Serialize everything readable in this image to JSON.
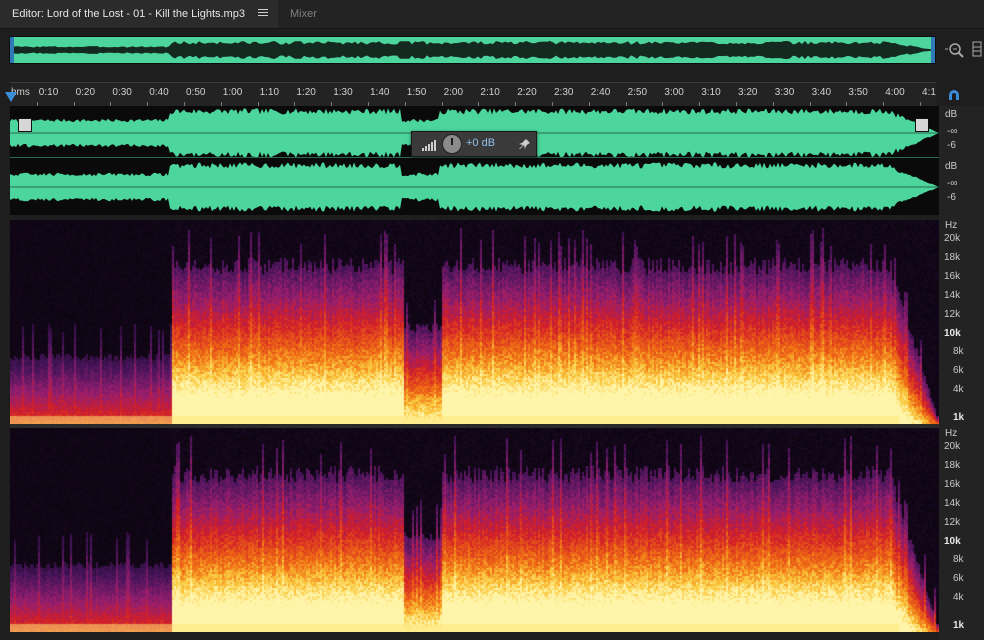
{
  "tabs": {
    "editor_label": "Editor: Lord of the Lost - 01 - Kill the Lights.mp3",
    "mixer_label": "Mixer"
  },
  "ruler": {
    "labels": [
      "hms",
      "0:10",
      "0:20",
      "0:30",
      "0:40",
      "0:50",
      "1:00",
      "1:10",
      "1:20",
      "1:30",
      "1:40",
      "1:50",
      "2:00",
      "2:10",
      "2:20",
      "2:30",
      "2:40",
      "2:50",
      "3:00",
      "3:10",
      "3:20",
      "3:30",
      "3:40",
      "3:50",
      "4:00",
      "4:1"
    ]
  },
  "hud": {
    "volume_value": "+0 dB"
  },
  "amplitude_scale": {
    "channel1": [
      "dB",
      "-∞",
      "-6"
    ],
    "channel2": [
      "dB",
      "-∞",
      "-6"
    ]
  },
  "frequency_scale": {
    "unit": "Hz",
    "labels": [
      "20k",
      "18k",
      "16k",
      "14k",
      "12k",
      "10k",
      "8k",
      "6k",
      "4k",
      "1k"
    ]
  },
  "icons": {
    "tab_menu": "hamburger-icon",
    "zoom": "zoom-icon",
    "snap": "snap-magnet-icon",
    "hud_meter": "level-meter-icon",
    "hud_knob": "volume-knob-icon",
    "hud_pin": "pin-icon",
    "fade_in": "fade-in-handle-icon",
    "fade_out": "fade-out-handle-icon"
  },
  "colors": {
    "waveform_bg": "#4cd59c",
    "waveform_fg": "#0a0a0a",
    "playhead": "#3a8bd8",
    "hud_value": "#8fc0e8"
  }
}
